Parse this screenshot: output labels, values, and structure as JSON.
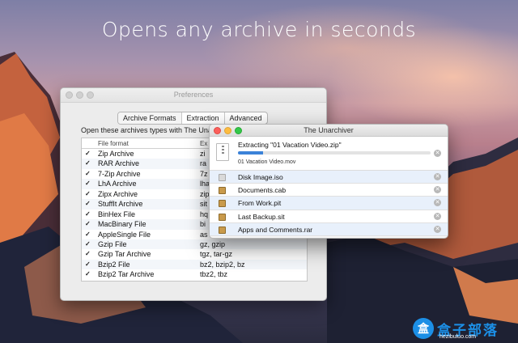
{
  "headline": "Opens any archive in seconds",
  "preferences": {
    "title": "Preferences",
    "tabs": [
      {
        "label": "Archive Formats",
        "selected": true
      },
      {
        "label": "Extraction",
        "selected": false
      },
      {
        "label": "Advanced",
        "selected": false
      }
    ],
    "description": "Open these archives types with The Una",
    "columns": {
      "format": "File format",
      "extensions": "Ex"
    },
    "rows": [
      {
        "format": "Zip Archive",
        "ext": "zi"
      },
      {
        "format": "RAR Archive",
        "ext": "ra"
      },
      {
        "format": "7-Zip Archive",
        "ext": "7z"
      },
      {
        "format": "LhA Archive",
        "ext": "lha"
      },
      {
        "format": "Zipx Archive",
        "ext": "zip"
      },
      {
        "format": "StuffIt Archive",
        "ext": "sit"
      },
      {
        "format": "BinHex File",
        "ext": "hq"
      },
      {
        "format": "MacBinary File",
        "ext": "bi"
      },
      {
        "format": "AppleSingle File",
        "ext": "as"
      },
      {
        "format": "Gzip File",
        "ext": "gz, gzip"
      },
      {
        "format": "Gzip Tar Archive",
        "ext": "tgz, tar-gz"
      },
      {
        "format": "Bzip2 File",
        "ext": "bz2, bzip2, bz"
      },
      {
        "format": "Bzip2 Tar Archive",
        "ext": "tbz2, tbz"
      }
    ]
  },
  "unarchiver": {
    "title": "The Unarchiver",
    "extracting": {
      "label": "Extracting \"01 Vacation Video.zip\"",
      "current_file": "01 Vacation Video.mov",
      "progress": 0.13
    },
    "queue": [
      {
        "name": "Disk Image.iso",
        "icon": "disk-image-icon"
      },
      {
        "name": "Documents.cab",
        "icon": "archive-box-icon"
      },
      {
        "name": "From Work.pit",
        "icon": "archive-box-icon"
      },
      {
        "name": "Last Backup.sit",
        "icon": "archive-box-icon"
      },
      {
        "name": "Apps and Comments.rar",
        "icon": "archive-box-icon"
      }
    ],
    "colors": {
      "accent": "#3b82d8",
      "row_highlight": "#e8f0fb"
    }
  },
  "watermark": {
    "logo_text": "盒",
    "text": "盒子部落",
    "url": "hezibuluo.com"
  }
}
